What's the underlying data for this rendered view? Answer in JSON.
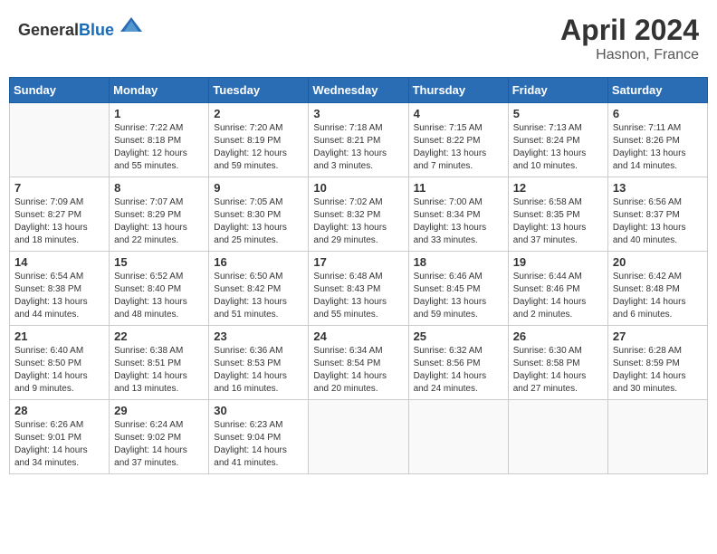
{
  "header": {
    "logo_general": "General",
    "logo_blue": "Blue",
    "title": "April 2024",
    "subtitle": "Hasnon, France"
  },
  "weekdays": [
    "Sunday",
    "Monday",
    "Tuesday",
    "Wednesday",
    "Thursday",
    "Friday",
    "Saturday"
  ],
  "weeks": [
    [
      {
        "day": "",
        "info": ""
      },
      {
        "day": "1",
        "info": "Sunrise: 7:22 AM\nSunset: 8:18 PM\nDaylight: 12 hours\nand 55 minutes."
      },
      {
        "day": "2",
        "info": "Sunrise: 7:20 AM\nSunset: 8:19 PM\nDaylight: 12 hours\nand 59 minutes."
      },
      {
        "day": "3",
        "info": "Sunrise: 7:18 AM\nSunset: 8:21 PM\nDaylight: 13 hours\nand 3 minutes."
      },
      {
        "day": "4",
        "info": "Sunrise: 7:15 AM\nSunset: 8:22 PM\nDaylight: 13 hours\nand 7 minutes."
      },
      {
        "day": "5",
        "info": "Sunrise: 7:13 AM\nSunset: 8:24 PM\nDaylight: 13 hours\nand 10 minutes."
      },
      {
        "day": "6",
        "info": "Sunrise: 7:11 AM\nSunset: 8:26 PM\nDaylight: 13 hours\nand 14 minutes."
      }
    ],
    [
      {
        "day": "7",
        "info": "Sunrise: 7:09 AM\nSunset: 8:27 PM\nDaylight: 13 hours\nand 18 minutes."
      },
      {
        "day": "8",
        "info": "Sunrise: 7:07 AM\nSunset: 8:29 PM\nDaylight: 13 hours\nand 22 minutes."
      },
      {
        "day": "9",
        "info": "Sunrise: 7:05 AM\nSunset: 8:30 PM\nDaylight: 13 hours\nand 25 minutes."
      },
      {
        "day": "10",
        "info": "Sunrise: 7:02 AM\nSunset: 8:32 PM\nDaylight: 13 hours\nand 29 minutes."
      },
      {
        "day": "11",
        "info": "Sunrise: 7:00 AM\nSunset: 8:34 PM\nDaylight: 13 hours\nand 33 minutes."
      },
      {
        "day": "12",
        "info": "Sunrise: 6:58 AM\nSunset: 8:35 PM\nDaylight: 13 hours\nand 37 minutes."
      },
      {
        "day": "13",
        "info": "Sunrise: 6:56 AM\nSunset: 8:37 PM\nDaylight: 13 hours\nand 40 minutes."
      }
    ],
    [
      {
        "day": "14",
        "info": "Sunrise: 6:54 AM\nSunset: 8:38 PM\nDaylight: 13 hours\nand 44 minutes."
      },
      {
        "day": "15",
        "info": "Sunrise: 6:52 AM\nSunset: 8:40 PM\nDaylight: 13 hours\nand 48 minutes."
      },
      {
        "day": "16",
        "info": "Sunrise: 6:50 AM\nSunset: 8:42 PM\nDaylight: 13 hours\nand 51 minutes."
      },
      {
        "day": "17",
        "info": "Sunrise: 6:48 AM\nSunset: 8:43 PM\nDaylight: 13 hours\nand 55 minutes."
      },
      {
        "day": "18",
        "info": "Sunrise: 6:46 AM\nSunset: 8:45 PM\nDaylight: 13 hours\nand 59 minutes."
      },
      {
        "day": "19",
        "info": "Sunrise: 6:44 AM\nSunset: 8:46 PM\nDaylight: 14 hours\nand 2 minutes."
      },
      {
        "day": "20",
        "info": "Sunrise: 6:42 AM\nSunset: 8:48 PM\nDaylight: 14 hours\nand 6 minutes."
      }
    ],
    [
      {
        "day": "21",
        "info": "Sunrise: 6:40 AM\nSunset: 8:50 PM\nDaylight: 14 hours\nand 9 minutes."
      },
      {
        "day": "22",
        "info": "Sunrise: 6:38 AM\nSunset: 8:51 PM\nDaylight: 14 hours\nand 13 minutes."
      },
      {
        "day": "23",
        "info": "Sunrise: 6:36 AM\nSunset: 8:53 PM\nDaylight: 14 hours\nand 16 minutes."
      },
      {
        "day": "24",
        "info": "Sunrise: 6:34 AM\nSunset: 8:54 PM\nDaylight: 14 hours\nand 20 minutes."
      },
      {
        "day": "25",
        "info": "Sunrise: 6:32 AM\nSunset: 8:56 PM\nDaylight: 14 hours\nand 24 minutes."
      },
      {
        "day": "26",
        "info": "Sunrise: 6:30 AM\nSunset: 8:58 PM\nDaylight: 14 hours\nand 27 minutes."
      },
      {
        "day": "27",
        "info": "Sunrise: 6:28 AM\nSunset: 8:59 PM\nDaylight: 14 hours\nand 30 minutes."
      }
    ],
    [
      {
        "day": "28",
        "info": "Sunrise: 6:26 AM\nSunset: 9:01 PM\nDaylight: 14 hours\nand 34 minutes."
      },
      {
        "day": "29",
        "info": "Sunrise: 6:24 AM\nSunset: 9:02 PM\nDaylight: 14 hours\nand 37 minutes."
      },
      {
        "day": "30",
        "info": "Sunrise: 6:23 AM\nSunset: 9:04 PM\nDaylight: 14 hours\nand 41 minutes."
      },
      {
        "day": "",
        "info": ""
      },
      {
        "day": "",
        "info": ""
      },
      {
        "day": "",
        "info": ""
      },
      {
        "day": "",
        "info": ""
      }
    ]
  ]
}
